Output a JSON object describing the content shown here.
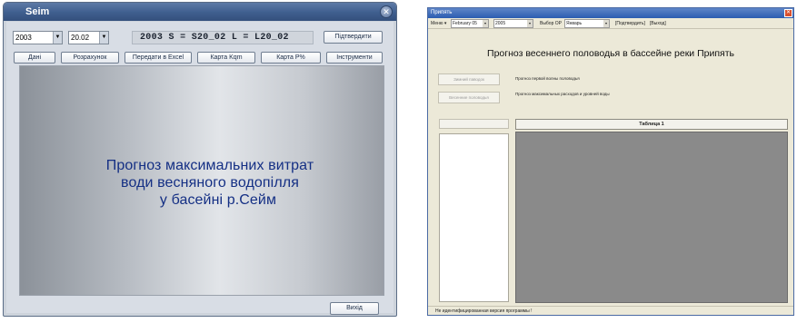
{
  "left_window": {
    "title": "Seim",
    "close_glyph": "✕",
    "year_select": {
      "value": "2003",
      "arrow": "▼"
    },
    "period_select": {
      "value": "20.02",
      "arrow": "▼"
    },
    "readout": "2003  S = S20_02  L = L20_02",
    "confirm_button": "Підтвердити",
    "buttons": [
      "Дані",
      "Розрахунок",
      "Передати в Excel",
      "Карта Kqm",
      "Карта P%",
      "Інструменти"
    ],
    "heading_lines": [
      "Прогноз максимальних витрат",
      "води весняного водопілля",
      "у басейні р.Сейм"
    ],
    "exit_button": "Вихід"
  },
  "right_window": {
    "title": "Припять",
    "close_glyph": "✕",
    "toolbar": {
      "menu_label": "Меню ▾",
      "date_select": {
        "value": "February 05",
        "arrow": "▾"
      },
      "year_select": {
        "value": "2005",
        "arrow": "▾"
      },
      "choice_label": "Выбор ОР",
      "month_select": {
        "value": "Январь",
        "arrow": "▾"
      },
      "confirm_link": "[Подтвердить]",
      "exit_link": "[Выход]"
    },
    "heading": "Прогноз весеннего половодья в бассейне реки Припять",
    "buttons": [
      {
        "label": "Зимний паводок",
        "description": "Прогноз первой волны половодья"
      },
      {
        "label": "Весенние половодья",
        "description": "Прогноз максимальных расходов и уровней воды"
      }
    ],
    "table_header": "Таблица 1",
    "status": "Не идентифицированная версия программы !"
  },
  "colors": {
    "left_titlebar": "#3f5e8e",
    "left_heading": "#142f84",
    "right_titlebar": "#2b5cb0",
    "right_table_fill": "#8a8a8a"
  }
}
